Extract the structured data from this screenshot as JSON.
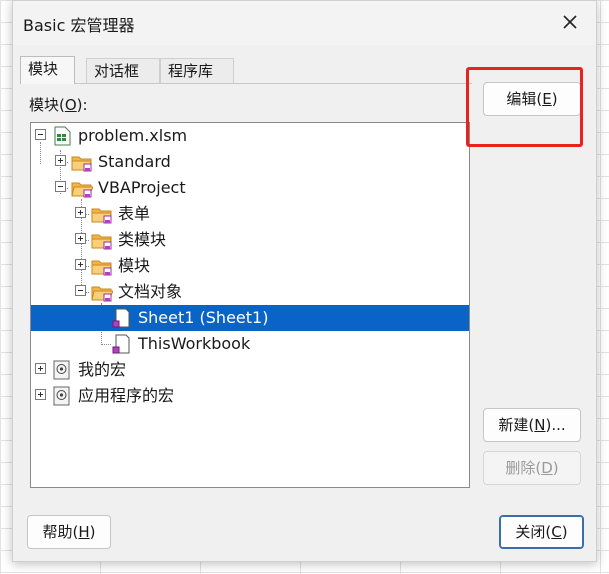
{
  "window": {
    "title": "Basic 宏管理器",
    "close_icon": "close-icon"
  },
  "tabs": [
    {
      "label": "模块",
      "active": true
    },
    {
      "label": "对话框",
      "active": false
    },
    {
      "label": "程序库",
      "active": false
    }
  ],
  "tree": {
    "label_prefix": "模块(",
    "label_accel": "O",
    "label_suffix": "):",
    "items": [
      {
        "label": "problem.xlsm",
        "icon": "spreadsheet-icon"
      },
      {
        "label": "Standard",
        "icon": "folder-icon"
      },
      {
        "label": "VBAProject",
        "icon": "folder-icon"
      },
      {
        "label": "表单",
        "icon": "folder-icon"
      },
      {
        "label": "类模块",
        "icon": "folder-icon"
      },
      {
        "label": "模块",
        "icon": "folder-icon"
      },
      {
        "label": "文档对象",
        "icon": "folder-icon"
      },
      {
        "label": "Sheet1 (Sheet1)",
        "icon": "document-icon",
        "selected": true
      },
      {
        "label": "ThisWorkbook",
        "icon": "document-icon"
      },
      {
        "label": "我的宏",
        "icon": "library-icon"
      },
      {
        "label": "应用程序的宏",
        "icon": "library-icon"
      }
    ]
  },
  "buttons": {
    "edit": {
      "prefix": "编辑(",
      "accel": "E",
      "suffix": ")"
    },
    "new": {
      "prefix": "新建(",
      "accel": "N",
      "suffix": ")..."
    },
    "delete": {
      "prefix": "删除(",
      "accel": "D",
      "suffix": ")",
      "disabled": true
    },
    "help": {
      "prefix": "帮助(",
      "accel": "H",
      "suffix": ")"
    },
    "close": {
      "prefix": "关闭(",
      "accel": "C",
      "suffix": ")"
    }
  },
  "colors": {
    "selection": "#0a64c8",
    "highlight_box": "#e8231f"
  }
}
